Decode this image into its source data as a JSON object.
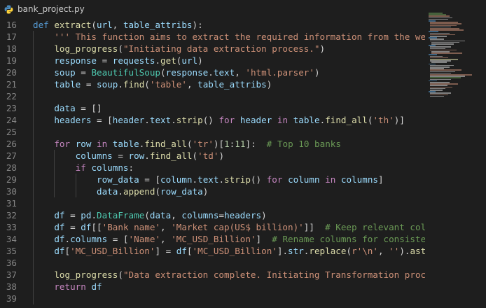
{
  "tab": {
    "filename": "bank_project.py",
    "icon": "python-file-icon"
  },
  "editor": {
    "line_numbers": [
      "16",
      "17",
      "18",
      "19",
      "20",
      "21",
      "22",
      "23",
      "24",
      "25",
      "26",
      "27",
      "28",
      "29",
      "30",
      "31",
      "32",
      "33",
      "34",
      "35",
      "36",
      "37",
      "38",
      "39"
    ],
    "lines": [
      [
        {
          "t": "def ",
          "c": "kw"
        },
        {
          "t": "extract",
          "c": "fn"
        },
        {
          "t": "(",
          "c": "p"
        },
        {
          "t": "url",
          "c": "var"
        },
        {
          "t": ", ",
          "c": "p"
        },
        {
          "t": "table_attribs",
          "c": "var"
        },
        {
          "t": "):",
          "c": "p"
        }
      ],
      [
        {
          "t": "    ",
          "c": "p"
        },
        {
          "t": "''' This function aims to extract the required information from the we",
          "c": "str"
        }
      ],
      [
        {
          "t": "    ",
          "c": "p"
        },
        {
          "t": "log_progress",
          "c": "fn"
        },
        {
          "t": "(",
          "c": "p"
        },
        {
          "t": "\"Initiating data extraction process.\"",
          "c": "str"
        },
        {
          "t": ")",
          "c": "p"
        }
      ],
      [
        {
          "t": "    ",
          "c": "p"
        },
        {
          "t": "response",
          "c": "var"
        },
        {
          "t": " = ",
          "c": "p"
        },
        {
          "t": "requests",
          "c": "var"
        },
        {
          "t": ".",
          "c": "p"
        },
        {
          "t": "get",
          "c": "fn"
        },
        {
          "t": "(",
          "c": "p"
        },
        {
          "t": "url",
          "c": "var"
        },
        {
          "t": ")",
          "c": "p"
        }
      ],
      [
        {
          "t": "    ",
          "c": "p"
        },
        {
          "t": "soup",
          "c": "var"
        },
        {
          "t": " = ",
          "c": "p"
        },
        {
          "t": "BeautifulSoup",
          "c": "cls"
        },
        {
          "t": "(",
          "c": "p"
        },
        {
          "t": "response",
          "c": "var"
        },
        {
          "t": ".",
          "c": "p"
        },
        {
          "t": "text",
          "c": "var"
        },
        {
          "t": ", ",
          "c": "p"
        },
        {
          "t": "'html.parser'",
          "c": "str"
        },
        {
          "t": ")",
          "c": "p"
        }
      ],
      [
        {
          "t": "    ",
          "c": "p"
        },
        {
          "t": "table",
          "c": "var"
        },
        {
          "t": " = ",
          "c": "p"
        },
        {
          "t": "soup",
          "c": "var"
        },
        {
          "t": ".",
          "c": "p"
        },
        {
          "t": "find",
          "c": "fn"
        },
        {
          "t": "(",
          "c": "p"
        },
        {
          "t": "'table'",
          "c": "str"
        },
        {
          "t": ", ",
          "c": "p"
        },
        {
          "t": "table_attribs",
          "c": "var"
        },
        {
          "t": ")",
          "c": "p"
        }
      ],
      [],
      [
        {
          "t": "    ",
          "c": "p"
        },
        {
          "t": "data",
          "c": "var"
        },
        {
          "t": " = []",
          "c": "p"
        }
      ],
      [
        {
          "t": "    ",
          "c": "p"
        },
        {
          "t": "headers",
          "c": "var"
        },
        {
          "t": " = [",
          "c": "p"
        },
        {
          "t": "header",
          "c": "var"
        },
        {
          "t": ".",
          "c": "p"
        },
        {
          "t": "text",
          "c": "var"
        },
        {
          "t": ".",
          "c": "p"
        },
        {
          "t": "strip",
          "c": "fn"
        },
        {
          "t": "() ",
          "c": "p"
        },
        {
          "t": "for",
          "c": "kw2"
        },
        {
          "t": " ",
          "c": "p"
        },
        {
          "t": "header",
          "c": "var"
        },
        {
          "t": " ",
          "c": "p"
        },
        {
          "t": "in",
          "c": "kw2"
        },
        {
          "t": " ",
          "c": "p"
        },
        {
          "t": "table",
          "c": "var"
        },
        {
          "t": ".",
          "c": "p"
        },
        {
          "t": "find_all",
          "c": "fn"
        },
        {
          "t": "(",
          "c": "p"
        },
        {
          "t": "'th'",
          "c": "str"
        },
        {
          "t": ")]",
          "c": "p"
        }
      ],
      [],
      [
        {
          "t": "    ",
          "c": "p"
        },
        {
          "t": "for",
          "c": "kw2"
        },
        {
          "t": " ",
          "c": "p"
        },
        {
          "t": "row",
          "c": "var"
        },
        {
          "t": " ",
          "c": "p"
        },
        {
          "t": "in",
          "c": "kw2"
        },
        {
          "t": " ",
          "c": "p"
        },
        {
          "t": "table",
          "c": "var"
        },
        {
          "t": ".",
          "c": "p"
        },
        {
          "t": "find_all",
          "c": "fn"
        },
        {
          "t": "(",
          "c": "p"
        },
        {
          "t": "'tr'",
          "c": "str"
        },
        {
          "t": ")[",
          "c": "p"
        },
        {
          "t": "1",
          "c": "num"
        },
        {
          "t": ":",
          "c": "p"
        },
        {
          "t": "11",
          "c": "num"
        },
        {
          "t": "]:  ",
          "c": "p"
        },
        {
          "t": "# Top 10 banks",
          "c": "cm"
        }
      ],
      [
        {
          "t": "        ",
          "c": "p"
        },
        {
          "t": "columns",
          "c": "var"
        },
        {
          "t": " = ",
          "c": "p"
        },
        {
          "t": "row",
          "c": "var"
        },
        {
          "t": ".",
          "c": "p"
        },
        {
          "t": "find_all",
          "c": "fn"
        },
        {
          "t": "(",
          "c": "p"
        },
        {
          "t": "'td'",
          "c": "str"
        },
        {
          "t": ")",
          "c": "p"
        }
      ],
      [
        {
          "t": "        ",
          "c": "p"
        },
        {
          "t": "if",
          "c": "kw2"
        },
        {
          "t": " ",
          "c": "p"
        },
        {
          "t": "columns",
          "c": "var"
        },
        {
          "t": ":",
          "c": "p"
        }
      ],
      [
        {
          "t": "            ",
          "c": "p"
        },
        {
          "t": "row_data",
          "c": "var"
        },
        {
          "t": " = [",
          "c": "p"
        },
        {
          "t": "column",
          "c": "var"
        },
        {
          "t": ".",
          "c": "p"
        },
        {
          "t": "text",
          "c": "var"
        },
        {
          "t": ".",
          "c": "p"
        },
        {
          "t": "strip",
          "c": "fn"
        },
        {
          "t": "() ",
          "c": "p"
        },
        {
          "t": "for",
          "c": "kw2"
        },
        {
          "t": " ",
          "c": "p"
        },
        {
          "t": "column",
          "c": "var"
        },
        {
          "t": " ",
          "c": "p"
        },
        {
          "t": "in",
          "c": "kw2"
        },
        {
          "t": " ",
          "c": "p"
        },
        {
          "t": "columns",
          "c": "var"
        },
        {
          "t": "]",
          "c": "p"
        }
      ],
      [
        {
          "t": "            ",
          "c": "p"
        },
        {
          "t": "data",
          "c": "var"
        },
        {
          "t": ".",
          "c": "p"
        },
        {
          "t": "append",
          "c": "fn"
        },
        {
          "t": "(",
          "c": "p"
        },
        {
          "t": "row_data",
          "c": "var"
        },
        {
          "t": ")",
          "c": "p"
        }
      ],
      [],
      [
        {
          "t": "    ",
          "c": "p"
        },
        {
          "t": "df",
          "c": "var"
        },
        {
          "t": " = ",
          "c": "p"
        },
        {
          "t": "pd",
          "c": "var"
        },
        {
          "t": ".",
          "c": "p"
        },
        {
          "t": "DataFrame",
          "c": "cls"
        },
        {
          "t": "(",
          "c": "p"
        },
        {
          "t": "data",
          "c": "var"
        },
        {
          "t": ", ",
          "c": "p"
        },
        {
          "t": "columns",
          "c": "var"
        },
        {
          "t": "=",
          "c": "p"
        },
        {
          "t": "headers",
          "c": "var"
        },
        {
          "t": ")",
          "c": "p"
        }
      ],
      [
        {
          "t": "    ",
          "c": "p"
        },
        {
          "t": "df",
          "c": "var"
        },
        {
          "t": " = ",
          "c": "p"
        },
        {
          "t": "df",
          "c": "var"
        },
        {
          "t": "[[",
          "c": "p"
        },
        {
          "t": "'Bank name'",
          "c": "str"
        },
        {
          "t": ", ",
          "c": "p"
        },
        {
          "t": "'Market cap(US$ billion)'",
          "c": "str"
        },
        {
          "t": "]]  ",
          "c": "p"
        },
        {
          "t": "# Keep relevant col",
          "c": "cm"
        }
      ],
      [
        {
          "t": "    ",
          "c": "p"
        },
        {
          "t": "df",
          "c": "var"
        },
        {
          "t": ".",
          "c": "p"
        },
        {
          "t": "columns",
          "c": "var"
        },
        {
          "t": " = [",
          "c": "p"
        },
        {
          "t": "'Name'",
          "c": "str"
        },
        {
          "t": ", ",
          "c": "p"
        },
        {
          "t": "'MC_USD_Billion'",
          "c": "str"
        },
        {
          "t": "]  ",
          "c": "p"
        },
        {
          "t": "# Rename columns for consiste",
          "c": "cm"
        }
      ],
      [
        {
          "t": "    ",
          "c": "p"
        },
        {
          "t": "df",
          "c": "var"
        },
        {
          "t": "[",
          "c": "p"
        },
        {
          "t": "'MC_USD_Billion'",
          "c": "str"
        },
        {
          "t": "] = ",
          "c": "p"
        },
        {
          "t": "df",
          "c": "var"
        },
        {
          "t": "[",
          "c": "p"
        },
        {
          "t": "'MC_USD_Billion'",
          "c": "str"
        },
        {
          "t": "].",
          "c": "p"
        },
        {
          "t": "str",
          "c": "var"
        },
        {
          "t": ".",
          "c": "p"
        },
        {
          "t": "replace",
          "c": "fn"
        },
        {
          "t": "(",
          "c": "p"
        },
        {
          "t": "r'\\n'",
          "c": "str"
        },
        {
          "t": ", ",
          "c": "p"
        },
        {
          "t": "''",
          "c": "str"
        },
        {
          "t": ").",
          "c": "p"
        },
        {
          "t": "ast",
          "c": "fn"
        }
      ],
      [],
      [
        {
          "t": "    ",
          "c": "p"
        },
        {
          "t": "log_progress",
          "c": "fn"
        },
        {
          "t": "(",
          "c": "p"
        },
        {
          "t": "\"Data extraction complete. Initiating Transformation proc",
          "c": "str"
        }
      ],
      [
        {
          "t": "    ",
          "c": "p"
        },
        {
          "t": "return",
          "c": "kw2"
        },
        {
          "t": " ",
          "c": "p"
        },
        {
          "t": "df",
          "c": "var"
        }
      ],
      []
    ]
  },
  "colors": {
    "background": "#1e1e1e",
    "keyword": "#569cd6",
    "control": "#c586c0",
    "function": "#dcdcaa",
    "string": "#ce9178",
    "comment": "#6a9955",
    "number": "#b5cea8",
    "variable": "#9cdcfe",
    "class": "#4ec9b0",
    "line_number": "#858585"
  }
}
